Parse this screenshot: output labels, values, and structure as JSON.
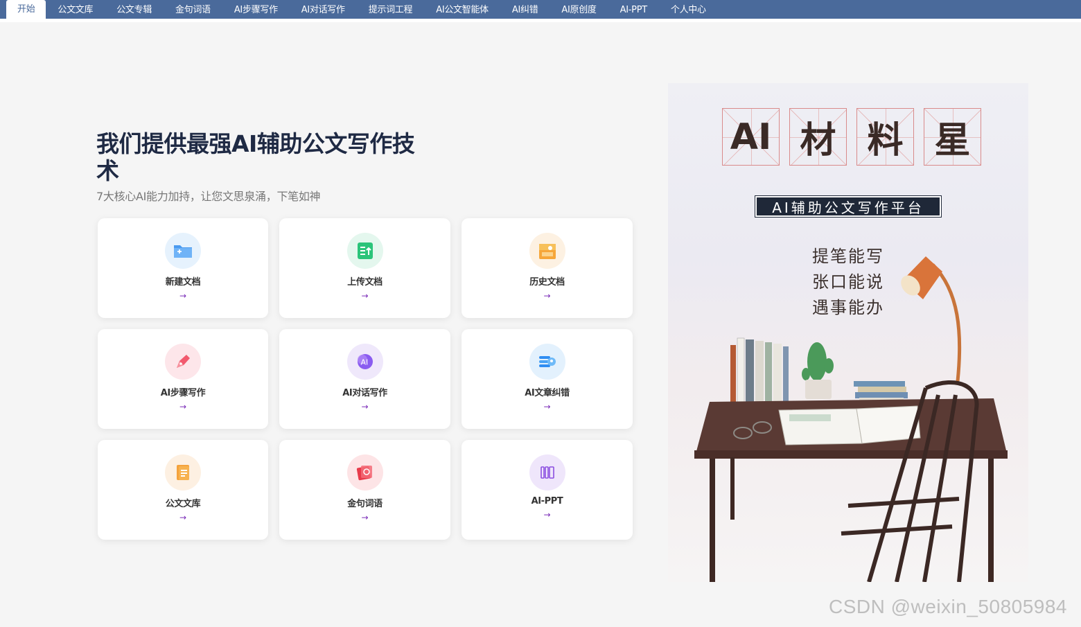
{
  "tabs": [
    {
      "label": "开始",
      "active": true
    },
    {
      "label": "公文文库"
    },
    {
      "label": "公文专辑"
    },
    {
      "label": "金句词语"
    },
    {
      "label": "AI步骤写作"
    },
    {
      "label": "AI对话写作"
    },
    {
      "label": "提示词工程"
    },
    {
      "label": "AI公文智能体"
    },
    {
      "label": "AI纠错"
    },
    {
      "label": "AI原创度"
    },
    {
      "label": "AI-PPT"
    },
    {
      "label": "个人中心"
    }
  ],
  "hero": {
    "title": "我们提供最强AI辅助公文写作技术",
    "subtitle": "7大核心AI能力加持，让您文思泉涌，下笔如神"
  },
  "cards": [
    {
      "label": "新建文档",
      "icon": "new-folder-icon",
      "arrow": "→"
    },
    {
      "label": "上传文档",
      "icon": "upload-doc-icon",
      "arrow": "→"
    },
    {
      "label": "历史文档",
      "icon": "history-box-icon",
      "arrow": "→"
    },
    {
      "label": "AI步骤写作",
      "icon": "pen-write-icon",
      "arrow": "→"
    },
    {
      "label": "AI对话写作",
      "icon": "ai-chat-icon",
      "arrow": "→"
    },
    {
      "label": "AI文章纠错",
      "icon": "proofread-icon",
      "arrow": "→"
    },
    {
      "label": "公文文库",
      "icon": "library-doc-icon",
      "arrow": "→"
    },
    {
      "label": "金句词语",
      "icon": "golden-quote-icon",
      "arrow": "→"
    },
    {
      "label": "AI-PPT",
      "icon": "ppt-icon",
      "arrow": "→"
    }
  ],
  "illustration": {
    "brand_chars": [
      "AI",
      "材",
      "料",
      "星"
    ],
    "platform_tag": "AI辅助公文写作平台",
    "slogan": [
      "提笔能写",
      "张口能说",
      "遇事能办"
    ]
  },
  "watermark": "CSDN @weixin_50805984"
}
